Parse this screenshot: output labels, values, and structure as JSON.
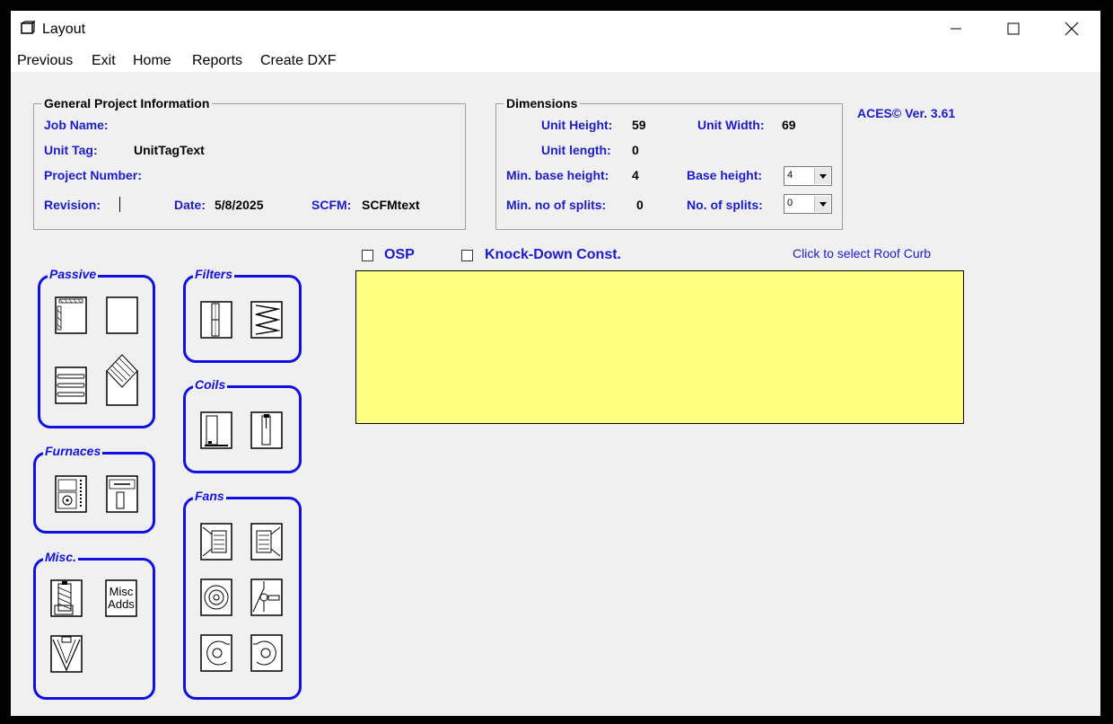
{
  "window": {
    "title": "Layout",
    "minimize_icon": "minimize-icon",
    "maximize_icon": "maximize-icon",
    "close_icon": "close-icon"
  },
  "menu": [
    "Previous",
    "Exit",
    "Home",
    "Reports",
    "Create DXF"
  ],
  "general": {
    "legend": "General Project Information",
    "job_name_label": "Job Name:",
    "job_name_value": "",
    "unit_tag_label": "Unit Tag:",
    "unit_tag_value": "UnitTagText",
    "project_number_label": "Project Number:",
    "project_number_value": "",
    "revision_label": "Revision:",
    "revision_value": "",
    "date_label": "Date:",
    "date_value": "5/8/2025",
    "scfm_label": "SCFM:",
    "scfm_value": "SCFMtext"
  },
  "dimensions": {
    "legend": "Dimensions",
    "unit_height_label": "Unit Height:",
    "unit_height_value": "59",
    "unit_width_label": "Unit Width:",
    "unit_width_value": "69",
    "unit_length_label": "Unit length:",
    "unit_length_value": "0",
    "min_base_height_label": "Min. base height:",
    "min_base_height_value": "4",
    "base_height_label": "Base height:",
    "base_height_value": "4",
    "min_splits_label": "Min. no of splits:",
    "min_splits_value": "0",
    "splits_label": "No. of splits:",
    "splits_value": "0"
  },
  "version": "ACES© Ver. 3.61",
  "options": {
    "osp_label": "OSP",
    "osp_checked": false,
    "knockdown_label": "Knock-Down Const.",
    "knockdown_checked": false
  },
  "roof_curb": {
    "link_label": "Click to select Roof Curb"
  },
  "palettes": {
    "passive": {
      "title": "Passive",
      "items": [
        "passive-section-1-icon",
        "blank-section-icon",
        "passive-section-3-icon",
        "passive-section-4-icon"
      ]
    },
    "filters": {
      "title": "Filters",
      "items": [
        "flat-filter-icon",
        "pleated-filter-icon"
      ]
    },
    "coils": {
      "title": "Coils",
      "items": [
        "coil-1-icon",
        "coil-2-icon"
      ]
    },
    "furnaces": {
      "title": "Furnaces",
      "items": [
        "furnace-1-icon",
        "furnace-2-icon"
      ]
    },
    "fans": {
      "title": "Fans",
      "items": [
        "fan-1-icon",
        "fan-2-icon",
        "fan-3-icon",
        "fan-4-icon",
        "fan-5-icon",
        "fan-6-icon"
      ]
    },
    "misc": {
      "title": "Misc.",
      "misc_adds_line1": "Misc",
      "misc_adds_line2": "Adds",
      "items": [
        "misc-1-icon",
        "misc-adds-icon",
        "misc-3-icon"
      ]
    }
  },
  "colors": {
    "label_blue": "#1c1ccc",
    "palette_border": "#1010e0",
    "curb_fill": "#ffff80",
    "background": "#f0f0f0"
  }
}
